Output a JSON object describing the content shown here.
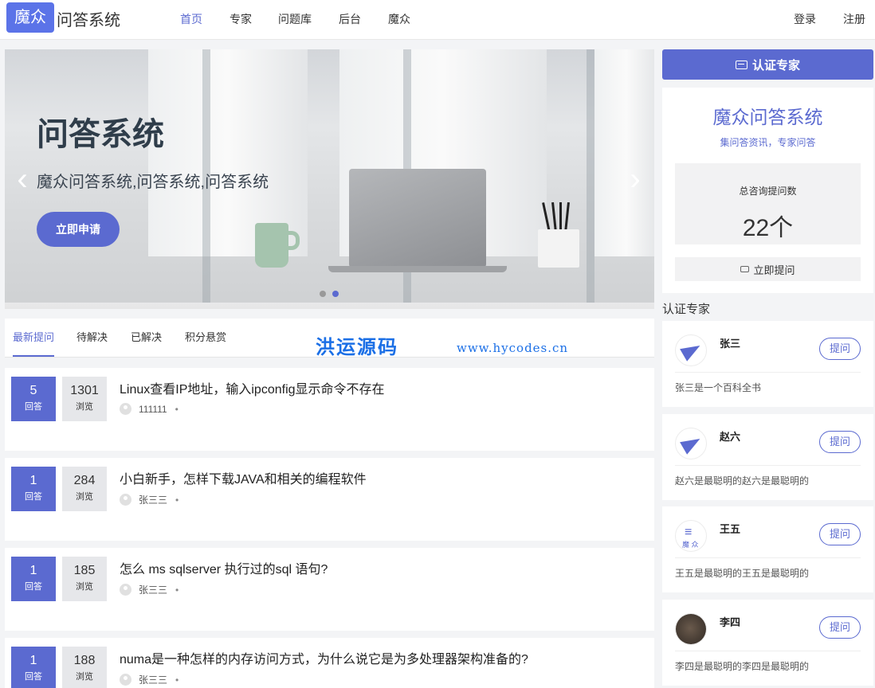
{
  "nav": {
    "logo_box": "魔众",
    "logo_text": "问答系统",
    "items": [
      {
        "label": "首页",
        "active": true
      },
      {
        "label": "专家",
        "active": false
      },
      {
        "label": "问题库",
        "active": false
      },
      {
        "label": "后台",
        "active": false
      },
      {
        "label": "魔众",
        "active": false
      }
    ],
    "login": "登录",
    "register": "注册"
  },
  "banner": {
    "title": "问答系统",
    "subtitle": "魔众问答系统,问答系统,问答系统",
    "button": "立即申请",
    "prev_icon": "chevron-left-icon",
    "next_icon": "chevron-right-icon",
    "slides": 2,
    "active_slide": 2
  },
  "tabs": [
    {
      "label": "最新提问",
      "active": true
    },
    {
      "label": "待解决",
      "active": false
    },
    {
      "label": "已解决",
      "active": false
    },
    {
      "label": "积分悬赏",
      "active": false
    }
  ],
  "watermark": {
    "cn": "洪运源码",
    "url": "www.hycodes.cn"
  },
  "questions": [
    {
      "answers": "5",
      "answers_label": "回答",
      "views": "1301",
      "views_label": "浏览",
      "title": "Linux查看IP地址，输入ipconfig显示命令不存在",
      "author": "111111",
      "sep": "•"
    },
    {
      "answers": "1",
      "answers_label": "回答",
      "views": "284",
      "views_label": "浏览",
      "title": "小白新手，怎样下载JAVA和相关的编程软件",
      "author": "张三三",
      "sep": "•"
    },
    {
      "answers": "1",
      "answers_label": "回答",
      "views": "185",
      "views_label": "浏览",
      "title": "怎么 ms sqlserver 执行过的sql 语句?",
      "author": "张三三",
      "sep": "•"
    },
    {
      "answers": "1",
      "answers_label": "回答",
      "views": "188",
      "views_label": "浏览",
      "title": "numa是一种怎样的内存访问方式，为什么说它是为多处理器架构准备的?",
      "author": "张三三",
      "sep": "•"
    }
  ],
  "sidebar": {
    "cert_button": "认证专家",
    "system": {
      "title": "魔众问答系统",
      "subtitle": "集问答资讯，专家问答",
      "stat_label": "总咨询提问数",
      "stat_value": "22个",
      "ask_button": "立即提问"
    },
    "experts_heading": "认证专家",
    "experts": [
      {
        "name": "张三",
        "desc": "张三是一个百科全书",
        "ask": "提问",
        "avatar": "plane"
      },
      {
        "name": "赵六",
        "desc": "赵六是最聪明的赵六是最聪明的",
        "ask": "提问",
        "avatar": "plane"
      },
      {
        "name": "王五",
        "desc": "王五是最聪明的王五是最聪明的",
        "ask": "提问",
        "avatar": "mozhong",
        "avatar_text": "魔 众"
      },
      {
        "name": "李四",
        "desc": "李四是最聪明的李四是最聪明的",
        "ask": "提问",
        "avatar": "photo"
      }
    ]
  },
  "colors": {
    "accent": "#5b6ad0",
    "logo": "#5b73e8",
    "watermark": "#1b6fe6"
  }
}
